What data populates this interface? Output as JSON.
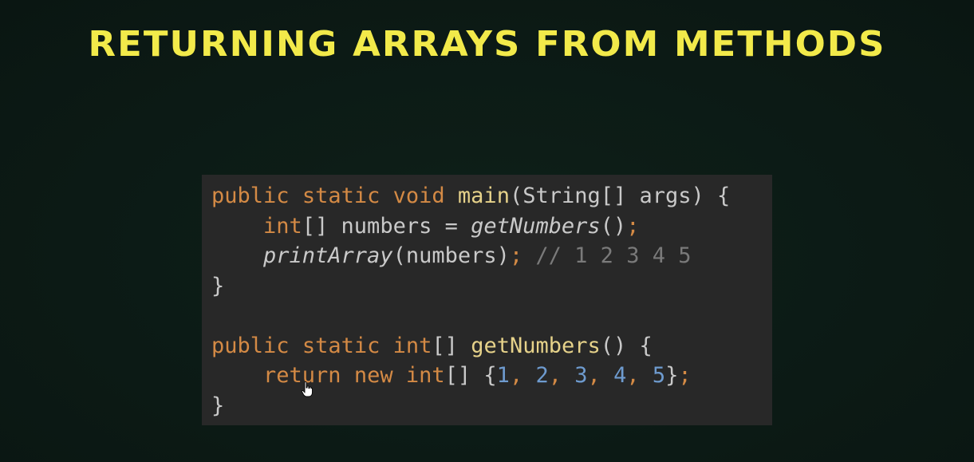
{
  "slide": {
    "title": "RETURNING ARRAYS FROM METHODS"
  },
  "code": {
    "line1": {
      "kw1": "public",
      "kw2": "static",
      "kw3": "void",
      "fn": "main",
      "rest": "(String[] args) {"
    },
    "line2": {
      "kw": "int",
      "mid": "[] numbers = ",
      "call": "getNumbers",
      "end": "()",
      "semi": ";"
    },
    "line3": {
      "call": "printArray",
      "args": "(numbers)",
      "semi": ";",
      "comment": "// 1 2 3 4 5"
    },
    "line4": {
      "brace": "}"
    },
    "line6": {
      "kw1": "public",
      "kw2": "static",
      "kw3": "int",
      "brackets": "[]",
      "fn": "getNumbers",
      "rest": "() {"
    },
    "line7": {
      "kw1": "return",
      "kw2": "new",
      "kw3": "int",
      "open": "[] {",
      "n1": "1",
      "n2": "2",
      "n3": "3",
      "n4": "4",
      "n5": "5",
      "comma": ",",
      "close": "}",
      "semi": ";"
    },
    "line8": {
      "brace": "}"
    }
  },
  "colors": {
    "title": "#f2ea4a",
    "keyword": "#d48a45",
    "function": "#e6d28a",
    "number": "#6e9bcf",
    "comment": "#7a7a7a",
    "panel": "#282828"
  },
  "icons": {
    "cursor": "hand-pointer-icon"
  }
}
